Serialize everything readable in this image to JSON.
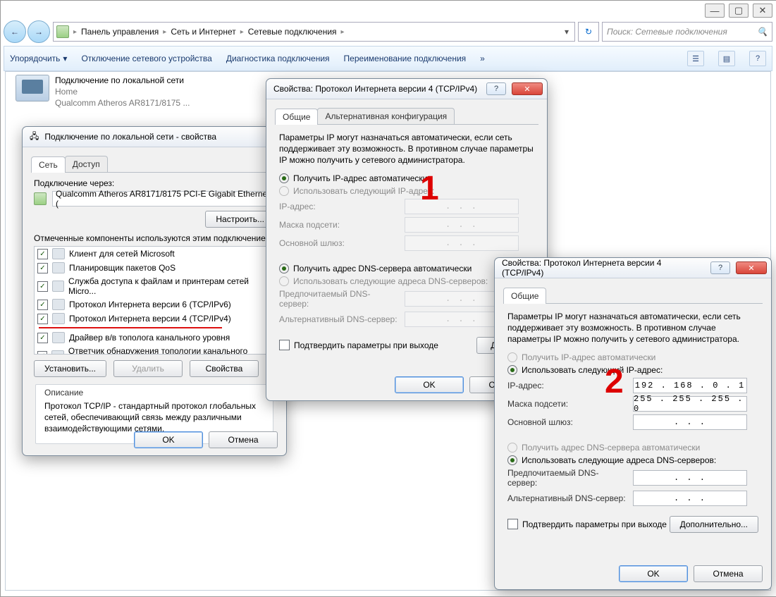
{
  "chrome": {
    "min": "—",
    "max": "▢",
    "close": "✕"
  },
  "nav": {
    "crumb1": "Панель управления",
    "crumb2": "Сеть и Интернет",
    "crumb3": "Сетевые подключения",
    "search_placeholder": "Поиск: Сетевые подключения",
    "back": "←",
    "fwd": "→",
    "dd": "▾",
    "refresh": "↻",
    "mag": "🔍"
  },
  "toolbar": {
    "organize": "Упорядочить",
    "disable": "Отключение сетевого устройства",
    "diag": "Диагностика подключения",
    "rename": "Переименование подключения",
    "more": "»",
    "view": "☰",
    "help": "?"
  },
  "adapter": {
    "l1": "Подключение по локальной сети",
    "l2": "Home",
    "l3": "Qualcomm Atheros AR8171/8175 ..."
  },
  "propsWin": {
    "title": "Подключение по локальной сети - свойства",
    "tabs": [
      "Сеть",
      "Доступ"
    ],
    "conn_through": "Подключение через:",
    "nic": "Qualcomm Atheros AR8171/8175 PCI-E Gigabit Ethernet (",
    "configure": "Настроить...",
    "components_label": "Отмеченные компоненты используются этим подключением",
    "items": [
      "Клиент для сетей Microsoft",
      "Планировщик пакетов QoS",
      "Служба доступа к файлам и принтерам сетей Micro...",
      "Протокол Интернета версии 6 (TCP/IPv6)",
      "Протокол Интернета версии 4 (TCP/IPv4)",
      "Драйвер в/в тополога канального уровня",
      "Ответчик обнаружения топологии канального уровн..."
    ],
    "install": "Установить...",
    "remove": "Удалить",
    "props": "Свойства",
    "desc_h": "Описание",
    "desc": "Протокол TCP/IP - стандартный протокол глобальных сетей, обеспечивающий связь между различными взаимодействующими сетями.",
    "ok": "OK",
    "cancel": "Отмена"
  },
  "ipv4a": {
    "title": "Свойства: Протокол Интернета версии 4 (TCP/IPv4)",
    "tabs": [
      "Общие",
      "Альтернативная конфигурация"
    ],
    "intro": "Параметры IP могут назначаться автоматически, если сеть поддерживает эту возможность. В противном случае параметры IP можно получить у сетевого администратора.",
    "r_auto_ip": "Получить IP-адрес автоматически",
    "r_manual_ip": "Использовать следующий IP-адрес:",
    "ip": "IP-адрес:",
    "mask": "Маска подсети:",
    "gw": "Основной шлюз:",
    "r_auto_dns": "Получить адрес DNS-сервера автоматически",
    "r_manual_dns": "Использовать следующие адреса DNS-серверов:",
    "dns1": "Предпочитаемый DNS-сервер:",
    "dns2": "Альтернативный DNS-сервер:",
    "validate": "Подтвердить параметры при выходе",
    "advanced": "Дополн",
    "ok": "OK",
    "cancel": "Отмена",
    "dots": ".   .   ."
  },
  "ipv4b": {
    "title": "Свойства: Протокол Интернета версии 4 (TCP/IPv4)",
    "tabs": [
      "Общие"
    ],
    "intro": "Параметры IP могут назначаться автоматически, если сеть поддерживает эту возможность. В противном случае параметры IP можно получить у сетевого администратора.",
    "r_auto_ip": "Получить IP-адрес автоматически",
    "r_manual_ip": "Использовать следующий IP-адрес:",
    "ip": "IP-адрес:",
    "mask": "Маска подсети:",
    "gw": "Основной шлюз:",
    "ip_v": "192 . 168 .  0  .  1",
    "mask_v": "255 . 255 . 255 .  0",
    "gw_v": ".       .       .",
    "r_auto_dns": "Получить адрес DNS-сервера автоматически",
    "r_manual_dns": "Использовать следующие адреса DNS-серверов:",
    "dns1": "Предпочитаемый DNS-сервер:",
    "dns2": "Альтернативный DNS-сервер:",
    "dns_v": ".       .       .",
    "validate": "Подтвердить параметры при выходе",
    "advanced": "Дополнительно...",
    "ok": "OK",
    "cancel": "Отмена"
  },
  "annot": {
    "one": "1",
    "two": "2"
  }
}
